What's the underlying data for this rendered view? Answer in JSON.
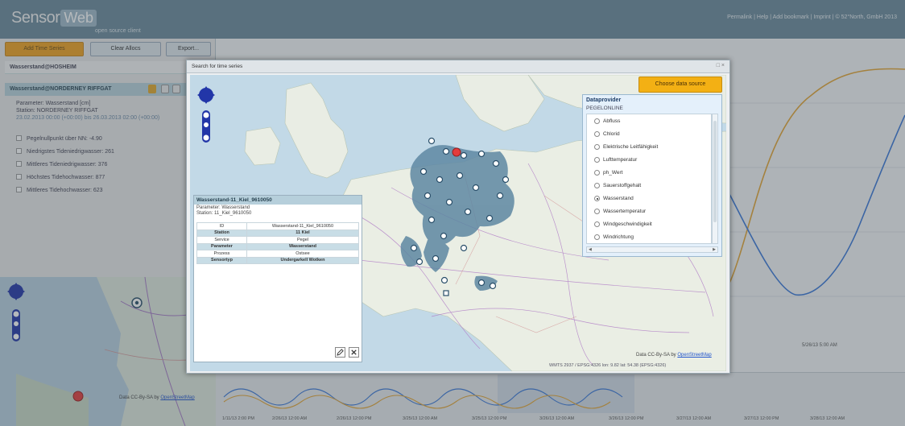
{
  "header": {
    "logo_part1": "Sensor",
    "logo_part2": "Web",
    "tagline": "open source client",
    "links": "Permalink | Help | Add bookmark | Imprint | © 52°North, GmbH 2013"
  },
  "toolbar": {
    "add_label": "Add Time Series",
    "clear_label": "Clear Allocs",
    "export_label": "Export..."
  },
  "legend": {
    "station_label": "Wasserstand@HOSHEIM",
    "ts_label": "Wasserstand@NORDERNEY RIFFGAT",
    "parameter": "Parameter: Wasserstand [cm]",
    "station": "Station: NORDERNEY RIFFGAT",
    "range": "23.02.2013 00:00 (+00:00) bis 26.03.2013 02:00 (+00:00)",
    "refs": [
      "Pegelnullpunkt über NN: -4.90",
      "Niedrigstes Tideniedrigwasser: 261",
      "Mittleres Tideniedrigwasser: 376",
      "Höchstes Tidehochwasser: 877",
      "Mittleres Tidehochwasser: 623"
    ]
  },
  "mini_map": {
    "attribution_text": "Data CC-By-SA by ",
    "attribution_link": "OpenStreetMap"
  },
  "chart": {
    "main_tick": "5/26/13 5:00 AM",
    "overview_ticks": [
      "1/11/13 2:00 PM",
      "2/26/13 12:00 AM",
      "2/26/13 12:00 PM",
      "3/25/13 12:00 AM",
      "3/25/13 12:00 PM",
      "3/26/13 12:00 AM",
      "3/26/13 12:00 PM",
      "3/27/13 12:00 AM",
      "3/27/13 12:00 PM",
      "3/28/13 12:00 AM"
    ],
    "series_colors": {
      "orange": "#e4a534",
      "blue": "#3a78d8"
    }
  },
  "dialog": {
    "title": "Search for time series",
    "win_buttons": "□ ×",
    "choose_btn": "Choose data source",
    "data_provider_title": "Dataprovider",
    "data_provider_sub": "PEGELONLINE",
    "providers": [
      {
        "label": "Abfluss",
        "selected": false
      },
      {
        "label": "Chlorid",
        "selected": false
      },
      {
        "label": "Elektrische Leitfähigkeit",
        "selected": false
      },
      {
        "label": "Lufttemperatur",
        "selected": false
      },
      {
        "label": "ph_Wert",
        "selected": false
      },
      {
        "label": "Sauerstoffgehalt",
        "selected": false
      },
      {
        "label": "Wasserstand",
        "selected": true
      },
      {
        "label": "Wassertemperatur",
        "selected": false
      },
      {
        "label": "Windgeschwindigkeit",
        "selected": false
      },
      {
        "label": "Windrichtung",
        "selected": false
      }
    ],
    "attribution_text": "Data CC-By-SA by ",
    "attribution_link": "OpenStreetMap",
    "coords": "WMTS 2937 / EPSG:4326 lon: 9.82  lat: 54.38 (EPSG:4326)"
  },
  "popup": {
    "title": "Wasserstand-11_Kiel_9610050",
    "parameter": "Parameter: Wasserstand",
    "station": "Station: 11_Kiel_9610050",
    "rows": [
      {
        "k": "ID",
        "v": "Wasserstand-11_Kiel_9610050"
      },
      {
        "k": "Station",
        "v": "11 Kiel"
      },
      {
        "k": "Service",
        "v": "Pegel"
      },
      {
        "k": "Parameter",
        "v": "Wasserstand"
      },
      {
        "k": "Prozess",
        "v": "Ostsee"
      },
      {
        "k": "Sensortyp",
        "v": "Undergarkell Wotken"
      }
    ]
  }
}
